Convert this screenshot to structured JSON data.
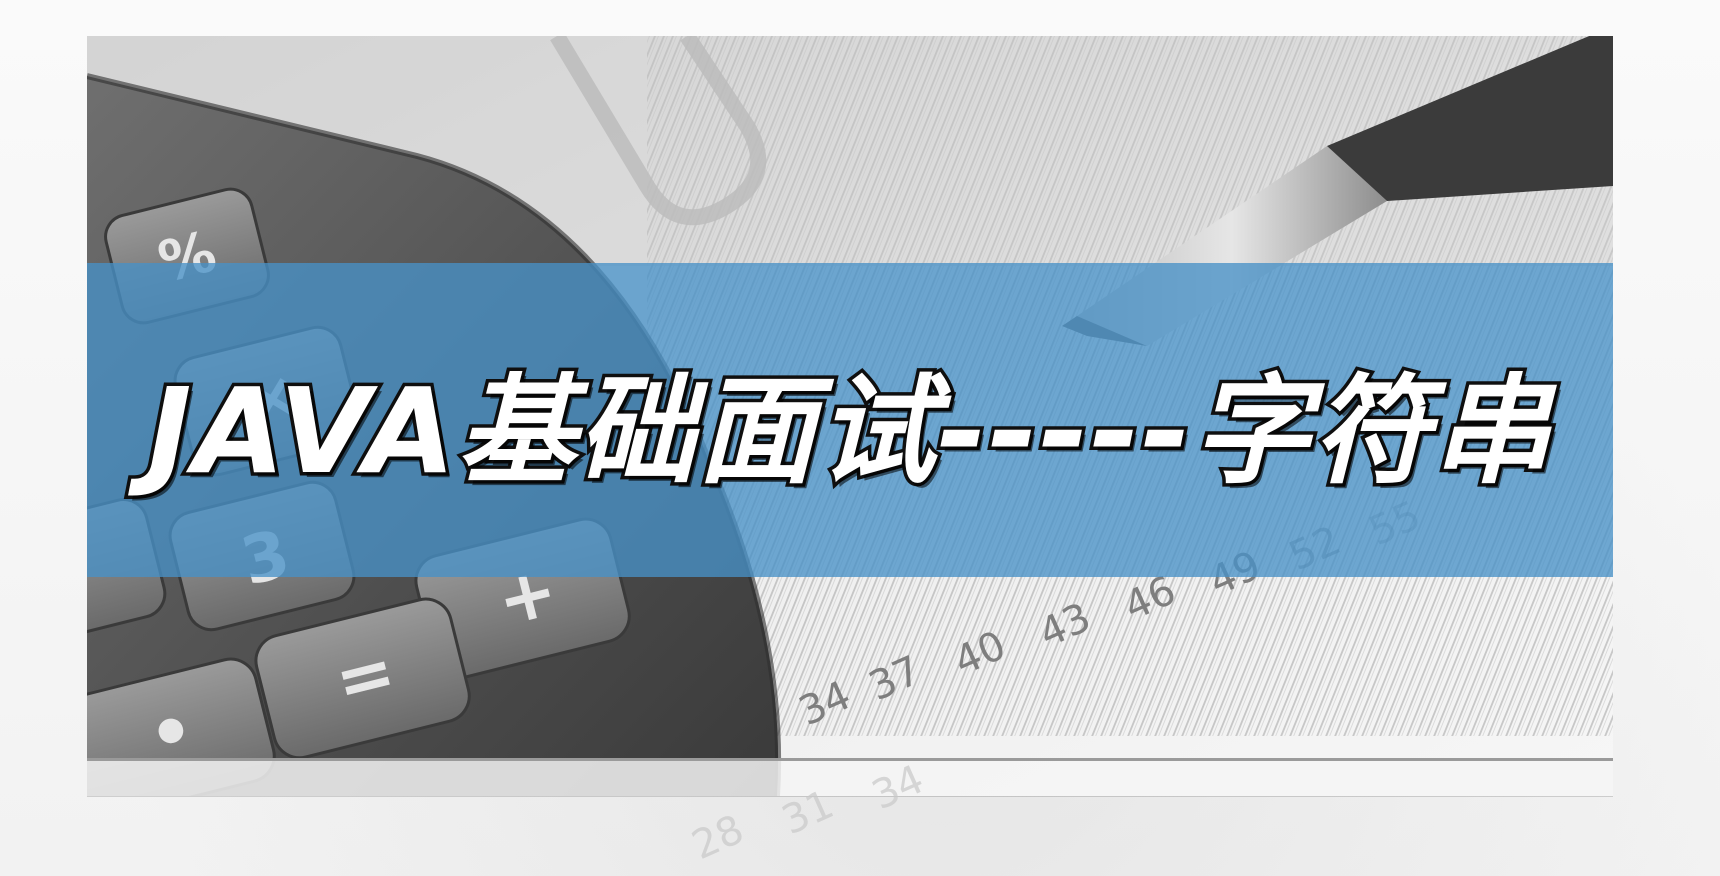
{
  "banner": {
    "title": "JAVA基础面试-----字符串",
    "band_color": "#4891c7"
  },
  "photo": {
    "scale_numbers": [
      "28",
      "31",
      "34",
      "37",
      "40",
      "43",
      "46",
      "49",
      "52",
      "55"
    ],
    "calculator_keys": [
      "%",
      "×",
      "3",
      "+",
      "=",
      "."
    ]
  }
}
